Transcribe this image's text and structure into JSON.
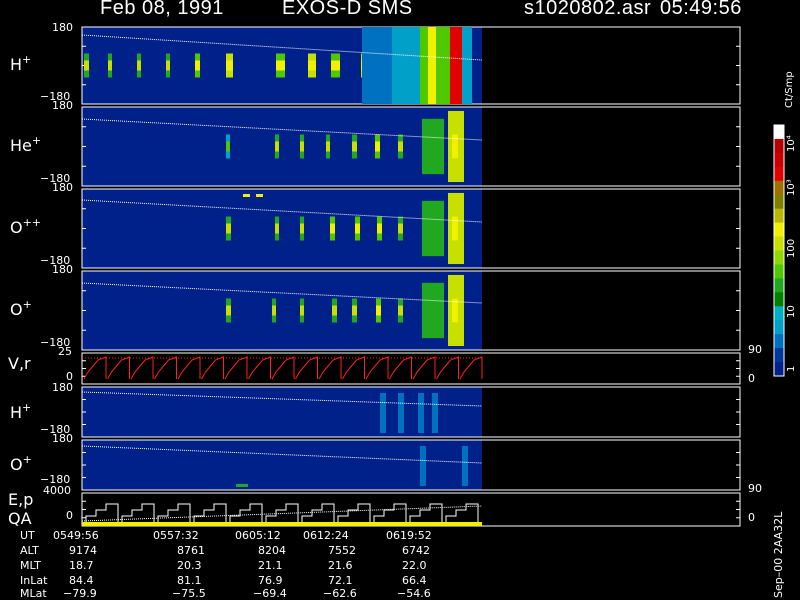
{
  "header": {
    "date": "Feb 08, 1991",
    "instrument": "EXOS-D SMS",
    "file": "s1020802.asr",
    "time": "05:49:56"
  },
  "panels": [
    {
      "label": "H",
      "sup": "+",
      "top": "180",
      "bottom": "−180"
    },
    {
      "label": "He",
      "sup": "+",
      "top": "180",
      "bottom": "−180"
    },
    {
      "label": "O",
      "sup": "++",
      "top": "180",
      "bottom": "−180"
    },
    {
      "label": "O",
      "sup": "+",
      "top": "180",
      "bottom": "−180"
    },
    {
      "label": "V,r",
      "sup": "",
      "top": "25",
      "bottom": "0",
      "right_top": "90",
      "right_bottom": "0"
    },
    {
      "label": "H",
      "sup": "+",
      "top": "180",
      "bottom": "−180"
    },
    {
      "label": "O",
      "sup": "+",
      "top": "180",
      "bottom": "−180"
    },
    {
      "label": "E,p",
      "label2": "QA",
      "sup": "",
      "top": "4000",
      "bottom": "0",
      "right_top": "90",
      "right_bottom": "0"
    }
  ],
  "colorbar": {
    "title": "Ct/Smp",
    "ticks": [
      "10⁴",
      "10³",
      "100",
      "10",
      "1"
    ],
    "colors": [
      "#ffffff",
      "#b40000",
      "#c80000",
      "#e00000",
      "#a07000",
      "#808000",
      "#b8b800",
      "#f0f000",
      "#c8e000",
      "#90d800",
      "#50c800",
      "#20a820",
      "#008000",
      "#00b0c0",
      "#00a0c8",
      "#0070c0",
      "#003898",
      "#00208a"
    ]
  },
  "footer": {
    "rows": [
      {
        "name": "UT",
        "values": [
          "0549:56",
          "0557:32",
          "0605:12",
          "0612:24",
          "0619:52"
        ]
      },
      {
        "name": "ALT",
        "values": [
          "9174",
          "8761",
          "8204",
          "7552",
          "6742"
        ]
      },
      {
        "name": "MLT",
        "values": [
          "18.7",
          "20.3",
          "21.1",
          "21.6",
          "22.0"
        ]
      },
      {
        "name": "InLat",
        "values": [
          "84.4",
          "81.1",
          "76.9",
          "72.1",
          "66.4"
        ]
      },
      {
        "name": "MLat",
        "values": [
          "−79.9",
          "−75.5",
          "−69.4",
          "−62.6",
          "−54.6"
        ]
      }
    ],
    "stamp": "Sep–00 2AA32L"
  },
  "chart_data": {
    "type": "heatmap",
    "panels": [
      "H+",
      "He+",
      "O++",
      "O+",
      "V,r",
      "H+",
      "O+",
      "E,p QA"
    ],
    "x_ticks": [
      "0549:56",
      "0557:32",
      "0605:12",
      "0612:24",
      "0619:52"
    ],
    "pitch_angle_range": [
      -180,
      180
    ],
    "velocity_range": [
      0,
      25
    ],
    "energy_range": [
      0,
      4000
    ],
    "colorbar_unit": "Ct/Smp",
    "colorbar_scale": "log",
    "colorbar_range": [
      1,
      10000
    ]
  }
}
